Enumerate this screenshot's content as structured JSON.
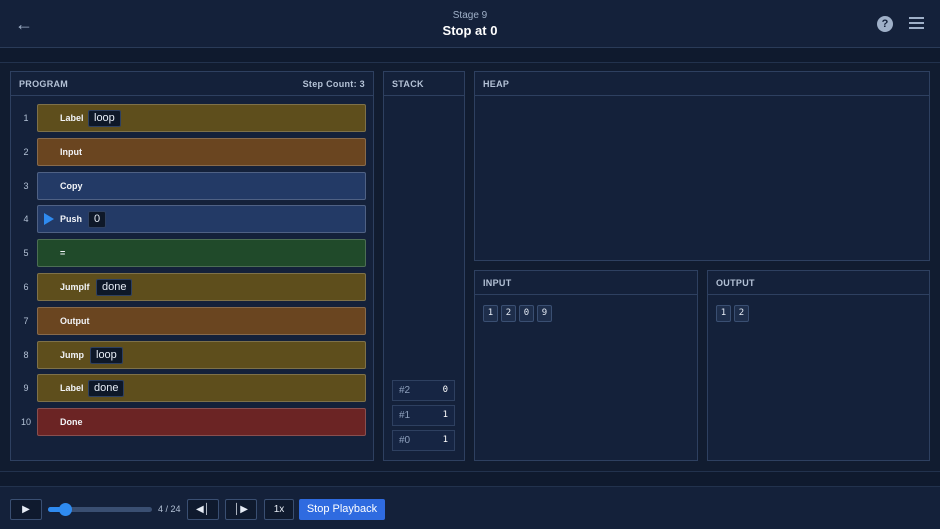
{
  "header": {
    "stage_label": "Stage 9",
    "title": "Stop at 0",
    "help_glyph": "?"
  },
  "program": {
    "title": "PROGRAM",
    "step_count_label": "Step Count: 3",
    "current_line": 4,
    "lines": [
      {
        "num": "1",
        "cmd": "Label",
        "arg": "loop",
        "color": "#5e4e1c"
      },
      {
        "num": "2",
        "cmd": "Input",
        "arg": "",
        "color": "#6a4520"
      },
      {
        "num": "3",
        "cmd": "Copy",
        "arg": "",
        "color": "#233a66"
      },
      {
        "num": "4",
        "cmd": "Push",
        "arg": "0",
        "color": "#233a66"
      },
      {
        "num": "5",
        "cmd": "=",
        "arg": "",
        "color": "#204a2a"
      },
      {
        "num": "6",
        "cmd": "JumpIf",
        "arg": "done",
        "color": "#5e4e1c"
      },
      {
        "num": "7",
        "cmd": "Output",
        "arg": "",
        "color": "#6a4520"
      },
      {
        "num": "8",
        "cmd": "Jump",
        "arg": "loop",
        "color": "#5e4e1c"
      },
      {
        "num": "9",
        "cmd": "Label",
        "arg": "done",
        "color": "#5e4e1c"
      },
      {
        "num": "10",
        "cmd": "Done",
        "arg": "",
        "color": "#6b2424"
      }
    ]
  },
  "stack": {
    "title": "STACK",
    "cells": [
      {
        "index": "#2",
        "value": "0"
      },
      {
        "index": "#1",
        "value": "1"
      },
      {
        "index": "#0",
        "value": "1"
      }
    ]
  },
  "heap": {
    "title": "HEAP"
  },
  "input": {
    "title": "INPUT",
    "items": [
      "1",
      "2",
      "0",
      "9"
    ]
  },
  "output": {
    "title": "OUTPUT",
    "items": [
      "1",
      "2"
    ]
  },
  "playback": {
    "position": 4,
    "total": 24,
    "counter_label": "4 / 24",
    "speed_label": "1x",
    "stop_label": "Stop Playback"
  },
  "colors": {
    "accent": "#2f8bf0",
    "primary_button": "#2f6be0"
  }
}
